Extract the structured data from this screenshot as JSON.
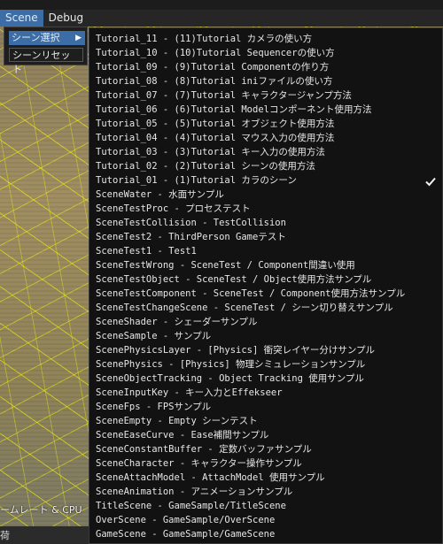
{
  "menubar": {
    "scene_label": "Scene",
    "debug_label": "Debug"
  },
  "scene_menu": {
    "select_label": "シーン選択",
    "reset_label": "シーンリセット"
  },
  "scenes": [
    {
      "label": "Tutorial_11 - (11)Tutorial カメラの使い方"
    },
    {
      "label": "Tutorial_10 - (10)Tutorial Sequencerの使い方"
    },
    {
      "label": "Tutorial_09 - (9)Tutorial Componentの作り方"
    },
    {
      "label": "Tutorial_08 - (8)Tutorial iniファイルの使い方"
    },
    {
      "label": "Tutorial_07 - (7)Tutorial キャラクタージャンプ方法"
    },
    {
      "label": "Tutorial_06 - (6)Tutorial Modelコンポーネント使用方法"
    },
    {
      "label": "Tutorial_05 - (5)Tutorial オブジェクト使用方法"
    },
    {
      "label": "Tutorial_04 - (4)Tutorial マウス入力の使用方法"
    },
    {
      "label": "Tutorial_03 - (3)Tutorial キー入力の使用方法"
    },
    {
      "label": "Tutorial_02 - (2)Tutorial シーンの使用方法"
    },
    {
      "label": "Tutorial_01 - (1)Tutorial カラのシーン",
      "checked": true
    },
    {
      "label": "SceneWater - 水面サンプル"
    },
    {
      "label": "SceneTestProc - プロセステスト"
    },
    {
      "label": "SceneTestCollision - TestCollision"
    },
    {
      "label": "SceneTest2 - ThirdPerson Gameテスト"
    },
    {
      "label": "SceneTest1 - Test1"
    },
    {
      "label": "SceneTestWrong - SceneTest / Component間違い使用"
    },
    {
      "label": "SceneTestObject - SceneTest / Object使用方法サンプル"
    },
    {
      "label": "SceneTestComponent - SceneTest / Component使用方法サンプル"
    },
    {
      "label": "SceneTestChangeScene - SceneTest / シーン切り替えサンプル"
    },
    {
      "label": "SceneShader - シェーダーサンプル"
    },
    {
      "label": "SceneSample - サンプル"
    },
    {
      "label": "ScenePhysicsLayer - [Physics] 衝突レイヤー分けサンプル"
    },
    {
      "label": "ScenePhysics - [Physics] 物理シミュレーションサンプル"
    },
    {
      "label": "SceneObjectTracking - Object Tracking 使用サンプル"
    },
    {
      "label": "SceneInputKey - キー入力とEffekseer"
    },
    {
      "label": "SceneFps - FPSサンプル"
    },
    {
      "label": "SceneEmpty - Empty シーンテスト"
    },
    {
      "label": "SceneEaseCurve - Ease補間サンプル"
    },
    {
      "label": "SceneConstantBuffer - 定数バッファサンプル"
    },
    {
      "label": "SceneCharacter - キャラクター操作サンプル"
    },
    {
      "label": "SceneAttachModel - AttachModel 使用サンプル"
    },
    {
      "label": "SceneAnimation - アニメーションサンプル"
    },
    {
      "label": "TitleScene - GameSample/TitleScene"
    },
    {
      "label": "OverScene - GameSample/OverScene"
    },
    {
      "label": "GameScene - GameSample/GameScene"
    }
  ],
  "hud": {
    "framerate_text": "ームレート & CPU",
    "bottom_text": "荷"
  },
  "colors": {
    "accent": "#3d6da7",
    "menu_bg": "#121212",
    "grid_line": "#ffff00"
  },
  "icons": {
    "submenu_arrow": "triangle-right-icon",
    "check": "check-icon"
  }
}
